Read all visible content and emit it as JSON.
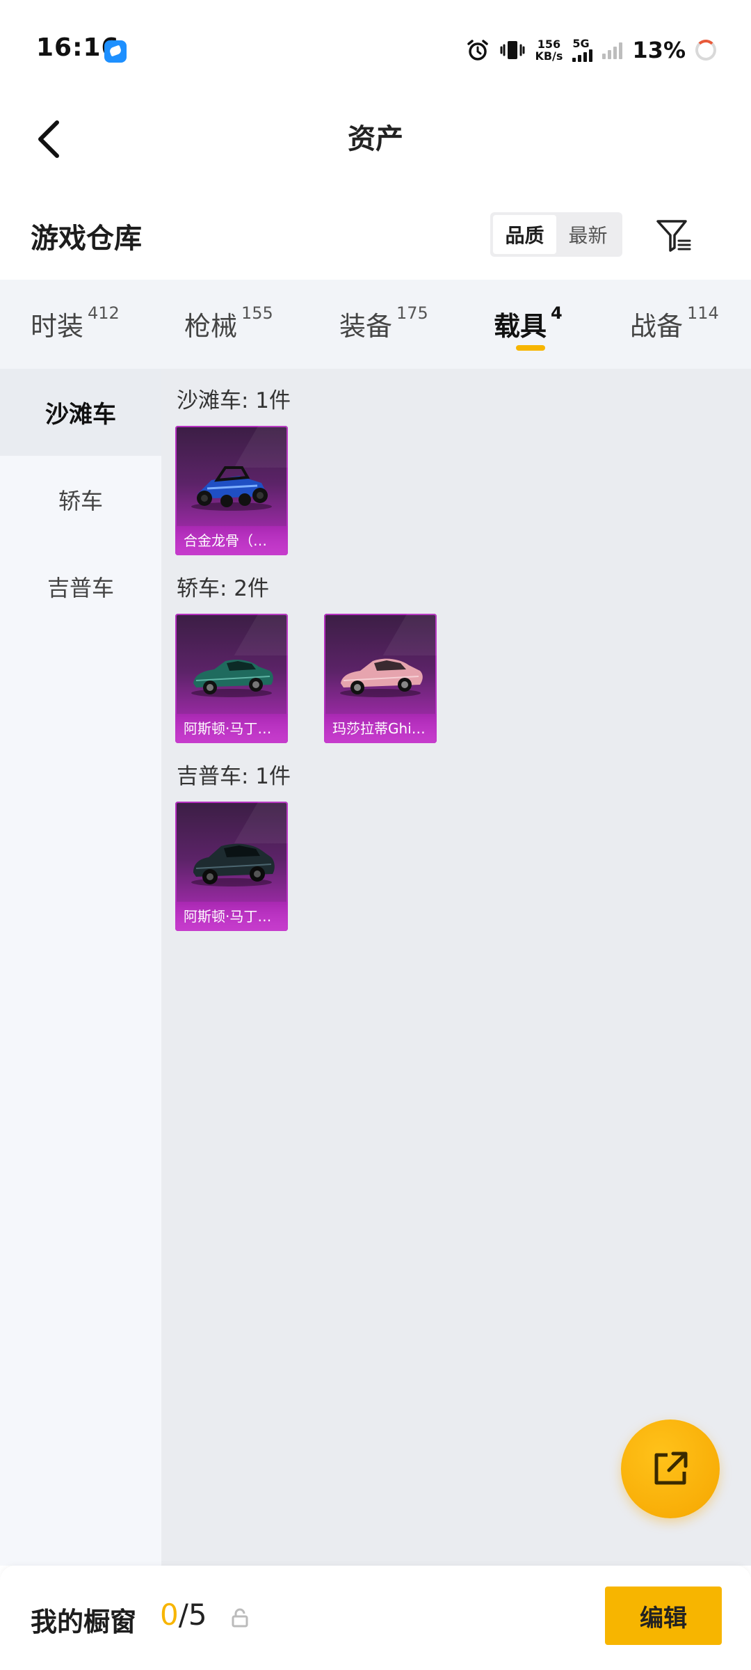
{
  "status_bar": {
    "time": "16:16",
    "net_speed_value": "156",
    "net_speed_unit": "KB/s",
    "network_type": "5G",
    "battery": "13%"
  },
  "header": {
    "title": "资产"
  },
  "warehouse": {
    "title": "游戏仓库",
    "sort_options": [
      "品质",
      "最新"
    ],
    "sort_selected": "品质"
  },
  "tabs": [
    {
      "label": "时装",
      "count": "412"
    },
    {
      "label": "枪械",
      "count": "155"
    },
    {
      "label": "装备",
      "count": "175"
    },
    {
      "label": "载具",
      "count": "4"
    },
    {
      "label": "战备",
      "count": "114"
    }
  ],
  "active_tab": "载具",
  "categories": [
    "沙滩车",
    "轿车",
    "吉普车"
  ],
  "active_category": "沙滩车",
  "groups": [
    {
      "label": "沙滩车: 1件",
      "items": [
        {
          "name": "合金龙骨（…"
        }
      ]
    },
    {
      "label": "轿车: 2件",
      "items": [
        {
          "name": "阿斯顿·马丁…"
        },
        {
          "name": "玛莎拉蒂Ghi…"
        }
      ]
    },
    {
      "label": "吉普车: 1件",
      "items": [
        {
          "name": "阿斯顿·马丁…"
        }
      ]
    }
  ],
  "bottom_bar": {
    "showcase_label": "我的橱窗",
    "showcase_current": "0",
    "showcase_total": "/5",
    "edit_label": "编辑"
  },
  "colors": {
    "accent": "#f7b500",
    "card_rarity": "#c33dca"
  },
  "icons": [
    "back-icon",
    "alarm-icon",
    "vibrate-icon",
    "filter-icon",
    "share-icon",
    "lock-icon"
  ]
}
